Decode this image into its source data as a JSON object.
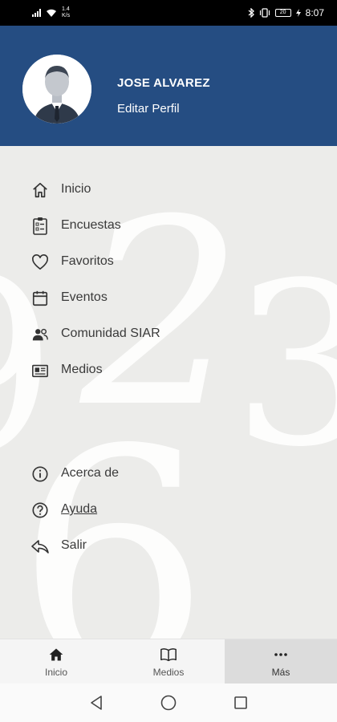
{
  "status_bar": {
    "speed_value": "1.4",
    "speed_unit": "K/s",
    "battery": "20",
    "time": "8:07"
  },
  "profile": {
    "name": "JOSE ALVAREZ",
    "edit_label": "Editar Perfil"
  },
  "menu": {
    "items": [
      {
        "label": "Inicio",
        "icon": "home-icon"
      },
      {
        "label": "Encuestas",
        "icon": "survey-icon"
      },
      {
        "label": "Favoritos",
        "icon": "heart-icon"
      },
      {
        "label": "Eventos",
        "icon": "calendar-icon"
      },
      {
        "label": "Comunidad SIAR",
        "icon": "people-icon"
      },
      {
        "label": "Medios",
        "icon": "newspaper-icon"
      }
    ],
    "secondary": [
      {
        "label": "Acerca de",
        "icon": "info-icon"
      },
      {
        "label": "Ayuda",
        "icon": "help-icon"
      },
      {
        "label": "Salir",
        "icon": "reply-icon"
      }
    ]
  },
  "bottom_nav": {
    "tabs": [
      {
        "label": "Inicio",
        "icon": "home-icon"
      },
      {
        "label": "Medios",
        "icon": "book-icon"
      },
      {
        "label": "Más",
        "icon": "more-icon"
      }
    ],
    "active_tab": "Más"
  },
  "colors": {
    "header_bg": "#254d82",
    "content_bg": "#ececea",
    "active_tab_bg": "#dcdcdc"
  }
}
